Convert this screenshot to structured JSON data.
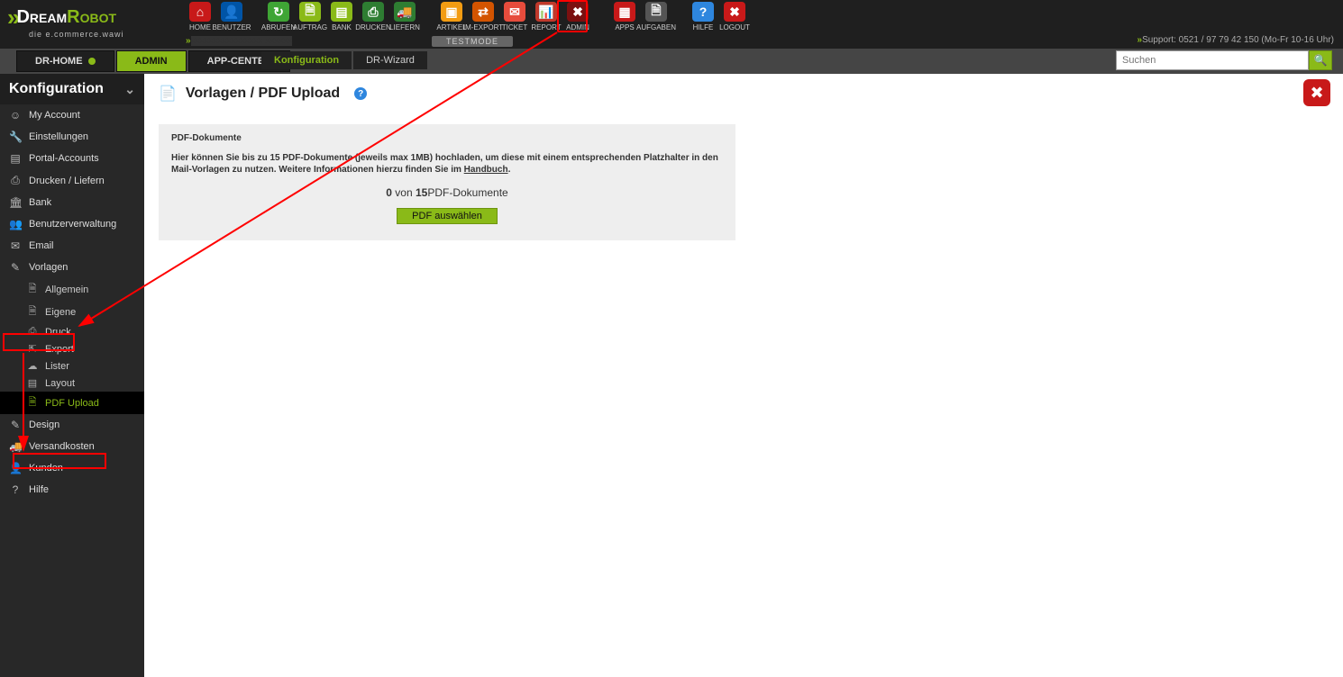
{
  "brand": {
    "dream": "Dream",
    "robot": "Robot",
    "sub": "die e.commerce.wawi"
  },
  "topnav": [
    {
      "label": "HOME",
      "bg": "bg-red",
      "glyph": "⌂"
    },
    {
      "label": "BENUTZER",
      "bg": "bg-blue",
      "glyph": "👤"
    },
    {
      "label": "ABRUFEN",
      "bg": "bg-green",
      "glyph": "↻"
    },
    {
      "label": "AUFTRAG",
      "bg": "bg-lime",
      "glyph": "🗎"
    },
    {
      "label": "BANK",
      "bg": "bg-lime",
      "glyph": "▤"
    },
    {
      "label": "DRUCKEN",
      "bg": "bg-dkgreen",
      "glyph": "⎙"
    },
    {
      "label": "LIEFERN",
      "bg": "bg-dkgreen",
      "glyph": "🚚"
    },
    {
      "label": "ARTIKEL",
      "bg": "bg-orange",
      "glyph": "▣"
    },
    {
      "label": "IM-EXPORT",
      "bg": "bg-dkorange",
      "glyph": "⇄"
    },
    {
      "label": "TICKET",
      "bg": "bg-bred",
      "glyph": "✉"
    },
    {
      "label": "REPORT",
      "bg": "bg-brick",
      "glyph": "📊"
    },
    {
      "label": "ADMIN",
      "bg": "bg-darkred",
      "glyph": "✖"
    },
    {
      "label": "APPS",
      "bg": "bg-grid",
      "glyph": "▦"
    },
    {
      "label": "AUFGABEN",
      "bg": "bg-grey",
      "glyph": "🗎"
    },
    {
      "label": "HILFE",
      "bg": "bg-hblue",
      "glyph": "?"
    },
    {
      "label": "LOGOUT",
      "bg": "bg-logout",
      "glyph": "✖"
    }
  ],
  "testmode": "TESTMODE",
  "support": "Support: 0521 / 97 79 42 150 (Mo-Fr 10-16 Uhr)",
  "secbar": {
    "tabs": [
      {
        "label": "DR-HOME",
        "dot": true
      },
      {
        "label": "ADMIN",
        "active": true
      },
      {
        "label": "APP-CENTER"
      }
    ],
    "subtabs": [
      {
        "label": "Konfiguration",
        "active": true
      },
      {
        "label": "DR-Wizard"
      }
    ],
    "search_placeholder": "Suchen"
  },
  "sidebar": {
    "title": "Konfiguration",
    "items": [
      {
        "icon": "☺",
        "label": "My Account"
      },
      {
        "icon": "🔧",
        "label": "Einstellungen"
      },
      {
        "icon": "▤",
        "label": "Portal-Accounts"
      },
      {
        "icon": "⎙",
        "label": "Drucken / Liefern"
      },
      {
        "icon": "🏛",
        "label": "Bank"
      },
      {
        "icon": "👥",
        "label": "Benutzerverwaltung"
      },
      {
        "icon": "✉",
        "label": "Email"
      },
      {
        "icon": "✎",
        "label": "Vorlagen"
      }
    ],
    "subs": [
      {
        "icon": "🗎",
        "label": "Allgemein"
      },
      {
        "icon": "🗎",
        "label": "Eigene"
      },
      {
        "icon": "⎙",
        "label": "Druck"
      },
      {
        "icon": "⇱",
        "label": "Export"
      },
      {
        "icon": "☁",
        "label": "Lister"
      },
      {
        "icon": "▤",
        "label": "Layout"
      },
      {
        "icon": "🗎",
        "label": "PDF Upload",
        "active": true
      }
    ],
    "after": [
      {
        "icon": "✎",
        "label": "Design"
      },
      {
        "icon": "🚚",
        "label": "Versandkosten"
      },
      {
        "icon": "👤",
        "label": "Kunden"
      },
      {
        "icon": "?",
        "label": "Hilfe"
      }
    ]
  },
  "page": {
    "title": "Vorlagen / PDF Upload",
    "panel_heading": "PDF-Dokumente",
    "panel_text_a": "Hier können Sie bis zu 15 PDF-Dokumente (jeweils max 1MB) hochladen, um diese mit einem entsprechenden Platzhalter in den Mail-Vorlagen zu nutzen. Weitere Informationen hierzu finden Sie im ",
    "panel_link": "Handbuch",
    "panel_text_b": ".",
    "count_cur": "0",
    "count_sep": " von ",
    "count_max": "15",
    "count_suffix": "PDF-Dokumente",
    "btn": "PDF auswählen"
  }
}
